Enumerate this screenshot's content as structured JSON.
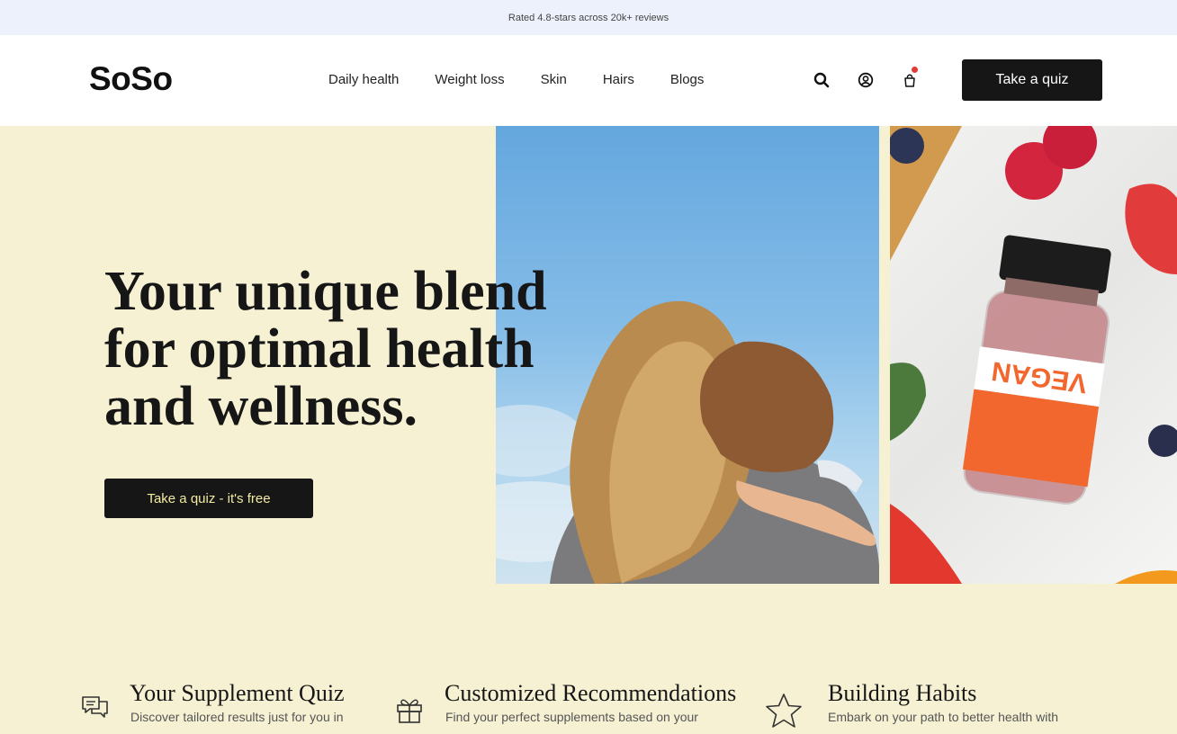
{
  "announcement": "Rated 4.8-stars across 20k+ reviews",
  "nav": {
    "logo": "SoSo",
    "links": [
      "Daily health",
      "Weight loss",
      "Skin",
      "Hairs",
      "Blogs"
    ],
    "icons": [
      "search-icon",
      "account-icon",
      "cart-icon"
    ],
    "cta": "Take a quiz"
  },
  "hero": {
    "headline": "Your unique blend for optimal health and wellness.",
    "cta": "Take a quiz - it's free",
    "jar_label": "VEGAN"
  },
  "features": [
    {
      "icon": "chat-icon",
      "title": "Your Supplement Quiz",
      "text": "Discover tailored results just for you in"
    },
    {
      "icon": "gift-icon",
      "title": "Customized Recommendations",
      "text": "Find your perfect supplements based on your"
    },
    {
      "icon": "star-icon",
      "title": "Building Habits",
      "text": "Embark on your path to better health with"
    }
  ],
  "colors": {
    "hero_bg": "#f6f1d3",
    "announcement_bg": "#edf1fb",
    "button_bg": "#161616",
    "hero_button_text": "#f2eba0",
    "jar_accent": "#f2672e"
  }
}
